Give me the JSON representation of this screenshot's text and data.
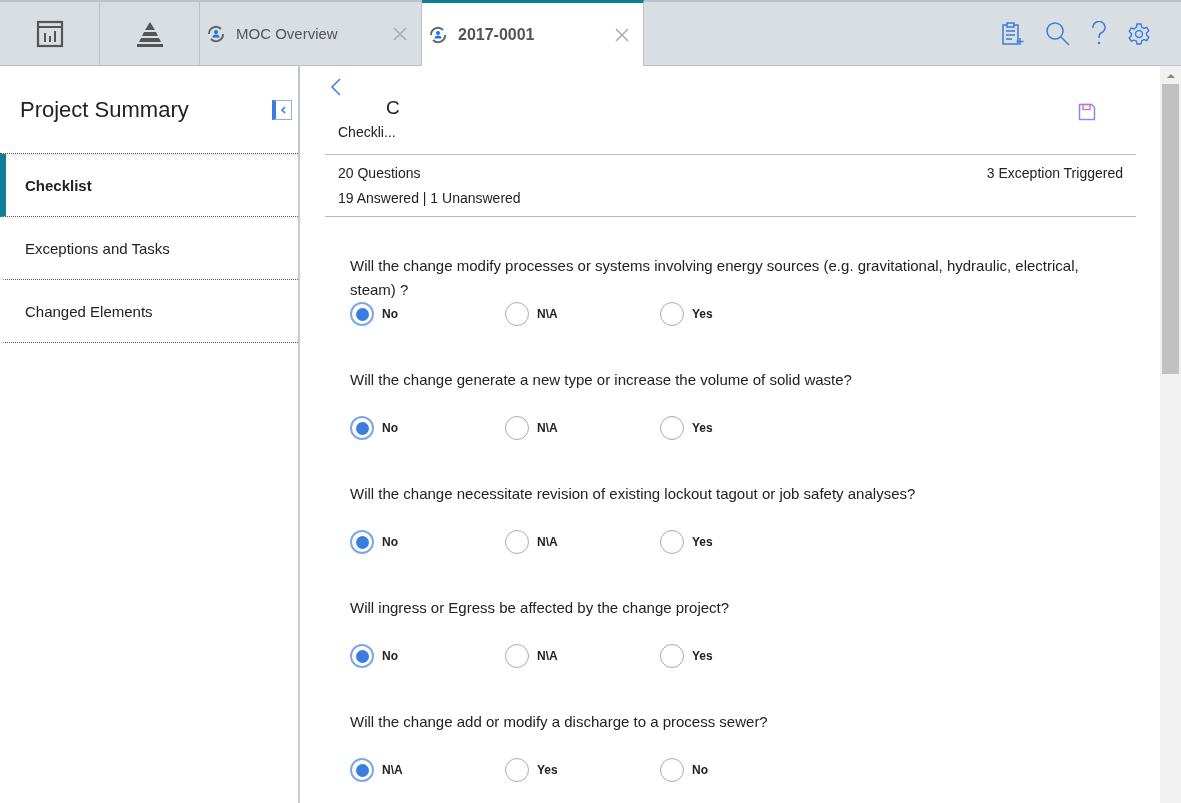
{
  "tabs": [
    {
      "kind": "report",
      "selected": false
    },
    {
      "kind": "pyramid",
      "selected": false
    },
    {
      "kind": "doc",
      "label": "MOC Overview",
      "selected": false
    },
    {
      "kind": "doc",
      "label": "2017-0001",
      "selected": true
    }
  ],
  "sidebar": {
    "title": "Project Summary",
    "items": [
      {
        "label": "Checklist",
        "selected": true
      },
      {
        "label": "Exceptions and Tasks",
        "selected": false
      },
      {
        "label": "Changed Elements",
        "selected": false
      }
    ]
  },
  "header": {
    "title": "C",
    "subtitle": "Checkli...",
    "questions": "20 Questions",
    "exceptions": "3 Exception Triggered",
    "answered": "19 Answered | 1 Unanswered"
  },
  "questions": [
    {
      "text": "Will the change modify processes or systems involving energy sources (e.g. gravitational, hydraulic, electrical, steam) ?",
      "options": [
        {
          "label": "No",
          "selected": true
        },
        {
          "label": "N\\A",
          "selected": false
        },
        {
          "label": "Yes",
          "selected": false
        }
      ]
    },
    {
      "text": "Will the change generate a new type or increase the volume of solid waste?",
      "options": [
        {
          "label": "No",
          "selected": true
        },
        {
          "label": "N\\A",
          "selected": false
        },
        {
          "label": "Yes",
          "selected": false
        }
      ]
    },
    {
      "text": "Will the change necessitate revision of existing lockout tagout or job safety analyses?",
      "options": [
        {
          "label": "No",
          "selected": true
        },
        {
          "label": "N\\A",
          "selected": false
        },
        {
          "label": "Yes",
          "selected": false
        }
      ]
    },
    {
      "text": "Will ingress or Egress be affected by the change project?",
      "options": [
        {
          "label": "No",
          "selected": true
        },
        {
          "label": "N\\A",
          "selected": false
        },
        {
          "label": "Yes",
          "selected": false
        }
      ]
    },
    {
      "text": "Will the change add or modify a discharge to a process sewer?",
      "options": [
        {
          "label": "N\\A",
          "selected": true
        },
        {
          "label": "Yes",
          "selected": false
        },
        {
          "label": "No",
          "selected": false
        }
      ]
    }
  ]
}
